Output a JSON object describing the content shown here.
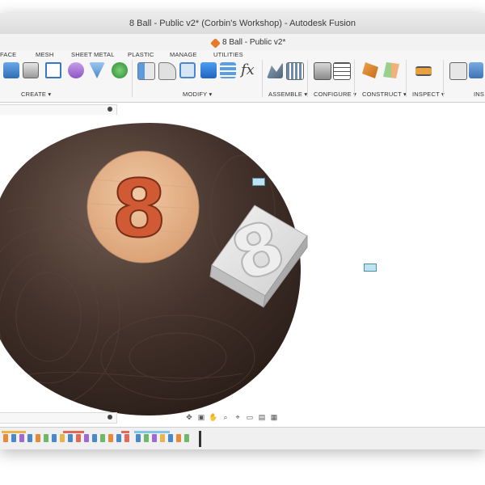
{
  "window": {
    "title": "8 Ball - Public v2* (Corbin's Workshop) - Autodesk Fusion",
    "document_tab": "8 Ball - Public v2*"
  },
  "ribbon": {
    "tabs": [
      {
        "label": "FACE"
      },
      {
        "label": "MESH"
      },
      {
        "label": "SHEET METAL"
      },
      {
        "label": "PLASTIC"
      },
      {
        "label": "MANAGE"
      },
      {
        "label": "UTILITIES"
      }
    ],
    "groups": [
      {
        "label": "CREATE ▾"
      },
      {
        "label": "MODIFY ▾"
      },
      {
        "label": "ASSEMBLE ▾"
      },
      {
        "label": "CONFIGURE ▾"
      },
      {
        "label": "CONSTRUCT ▾"
      },
      {
        "label": "INSPECT ▾"
      },
      {
        "label": "INS"
      }
    ],
    "function_label": "fx"
  },
  "canvas": {
    "ball_number": "8",
    "block_number": "8"
  },
  "colors": {
    "ball_dark": "#3a2a24",
    "ball_light": "#6e5a4f",
    "face_wood": "#e6b48c",
    "number_red": "#cf5a34",
    "block_gray": "#d9d9d9",
    "joint_blue": "#4f8ca8"
  },
  "icons": [
    "extrude-icon",
    "revolve-icon",
    "box-icon",
    "sketch-icon",
    "plastic-icon",
    "sheet-metal-icon",
    "mesh-icon",
    "press-pull-icon",
    "fillet-icon",
    "shell-icon",
    "combine-icon",
    "align-icon",
    "joint-icon",
    "table-icon",
    "plane-icon",
    "axis-icon",
    "measure-icon",
    "insert-icon",
    "orbit-icon",
    "pan-icon",
    "zoom-icon",
    "display-icon",
    "grid-icon"
  ]
}
